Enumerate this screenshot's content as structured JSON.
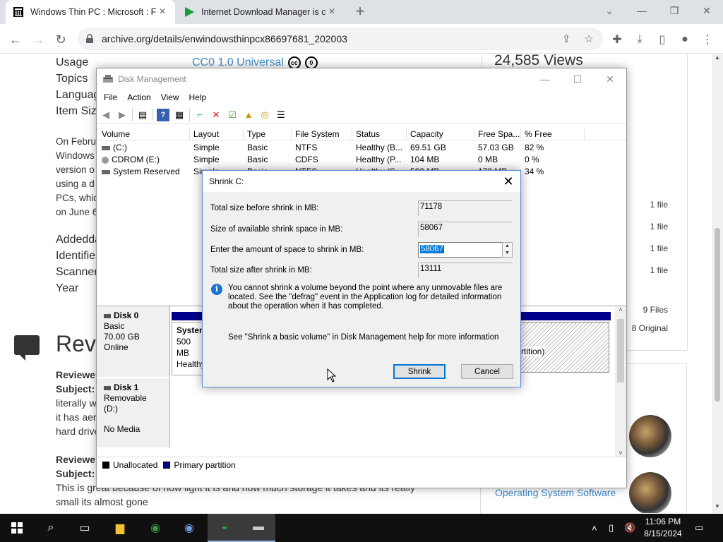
{
  "browser": {
    "tabs": [
      {
        "title": "Windows Thin PC : Microsoft : F",
        "active": true
      },
      {
        "title": "Internet Download Manager is c",
        "active": false
      }
    ],
    "url": "archive.org/details/enwindowsthinpcx86697681_202003"
  },
  "page": {
    "meta_labels": [
      "Usage",
      "Topics",
      "Languag",
      "Item Siz"
    ],
    "license_text": "CC0 1.0 Universal",
    "views": "24,585 Views",
    "description_lines": [
      "On Febru",
      "Windows",
      "version o",
      "using a d",
      "PCs, whic",
      "on June 6"
    ],
    "meta_labels2": [
      "Addeddat",
      "Identifie",
      "Scanner",
      "Year"
    ],
    "file_counts": [
      "1 file",
      "1 file",
      "1 file",
      "1 file"
    ],
    "files_total": "9 Files",
    "files_original": "8 Original",
    "reviews_heading": "Revi",
    "review1": {
      "reviewer": "Reviewe",
      "subject": "Subject:",
      "lines": [
        "literally w",
        "it has aer",
        "hard drive"
      ]
    },
    "review2": {
      "reviewer": "Reviewe",
      "subject": "Subject:",
      "lines": [
        "This is great because of how light it is and how much storage it takes and its really",
        "small its almost gone"
      ]
    },
    "os_link": "Operating System Software"
  },
  "disk_mgmt": {
    "title": "Disk Management",
    "menu": [
      "File",
      "Action",
      "View",
      "Help"
    ],
    "columns": [
      "Volume",
      "Layout",
      "Type",
      "File System",
      "Status",
      "Capacity",
      "Free Spa...",
      "% Free"
    ],
    "volumes": [
      {
        "volume": "(C:)",
        "layout": "Simple",
        "type": "Basic",
        "fs": "NTFS",
        "status": "Healthy (B...",
        "capacity": "69.51 GB",
        "free": "57.03 GB",
        "pct": "82 %"
      },
      {
        "volume": "CDROM (E:)",
        "layout": "Simple",
        "type": "Basic",
        "fs": "CDFS",
        "status": "Healthy (P...",
        "capacity": "104 MB",
        "free": "0 MB",
        "pct": "0 %"
      },
      {
        "volume": "System Reserved",
        "layout": "Simple",
        "type": "Basic",
        "fs": "NTFS",
        "status": "Healthy (S...",
        "capacity": "500 MB",
        "free": "173 MB",
        "pct": "34 %"
      }
    ],
    "disk0": {
      "name": "Disk 0",
      "type": "Basic",
      "size": "70.00 GB",
      "state": "Online"
    },
    "disk0_sys_part": {
      "name": "System",
      "size": "500 MB",
      "status": "Healthy"
    },
    "disk0_c_part_tail": "rtition)",
    "disk1": {
      "name": "Disk 1",
      "type": "Removable (D:)",
      "state": "No Media"
    },
    "legend": [
      "Unallocated",
      "Primary partition"
    ],
    "legend_colors": {
      "unallocated": "#000000",
      "primary": "#00008b"
    }
  },
  "shrink_dialog": {
    "title": "Shrink C:",
    "total_before_label": "Total size before shrink in MB:",
    "total_before_value": "71178",
    "available_label": "Size of available shrink space in MB:",
    "available_value": "58067",
    "amount_label": "Enter the amount of space to shrink in MB:",
    "amount_value": "58067",
    "total_after_label": "Total size after shrink in MB:",
    "total_after_value": "13111",
    "info_text": "You cannot shrink a volume beyond the point where any unmovable files are located. See the \"defrag\" event in the Application log for detailed information about the operation when it has completed.",
    "help_text": "See \"Shrink a basic volume\" in Disk Management help for more information",
    "shrink_button": "Shrink",
    "cancel_button": "Cancel"
  },
  "taskbar": {
    "time": "11:06 PM",
    "date": "8/15/2024"
  }
}
